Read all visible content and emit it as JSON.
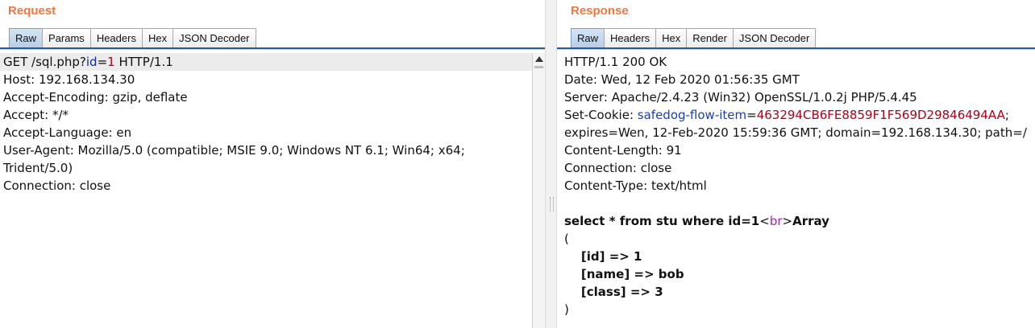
{
  "request": {
    "title": "Request",
    "tabs": [
      "Raw",
      "Params",
      "Headers",
      "Hex",
      "JSON Decoder"
    ],
    "active_tab": "Raw",
    "lines": {
      "l1_prefix": "GET /sql.php?",
      "l1_param": "id",
      "l1_eq": "=",
      "l1_val": "1",
      "l1_suffix": " HTTP/1.1",
      "l2": "Host: 192.168.134.30",
      "l3": "Accept-Encoding: gzip, deflate",
      "l4": "Accept: */*",
      "l5": "Accept-Language: en",
      "l6": "User-Agent: Mozilla/5.0 (compatible; MSIE 9.0; Windows NT 6.1; Win64; x64;",
      "l7": "Trident/5.0)",
      "l8": "Connection: close"
    }
  },
  "response": {
    "title": "Response",
    "tabs": [
      "Raw",
      "Headers",
      "Hex",
      "Render",
      "JSON Decoder"
    ],
    "active_tab": "Raw",
    "lines": {
      "l1": "HTTP/1.1 200 OK",
      "l2": "Date: Wed, 12 Feb 2020 01:56:35 GMT",
      "l3": "Server: Apache/2.4.23 (Win32) OpenSSL/1.0.2j PHP/5.4.45",
      "l4_prefix": "Set-Cookie: ",
      "l4_name": "safedog-flow-item",
      "l4_eq": "=",
      "l4_val": "463294CB6FE8859F1F569D29846494AA",
      "l4_suffix": ";",
      "l5": "expires=Wen, 12-Feb-2020 15:59:36 GMT; domain=192.168.134.30; path=/",
      "l6": "Content-Length: 91",
      "l7": "Connection: close",
      "l8": "Content-Type: text/html",
      "l10_a": "select * from stu where id=1",
      "l10_lt": "<",
      "l10_tag": "br",
      "l10_gt": ">",
      "l10_b": "Array",
      "l11": "(",
      "l12": "    [id] => 1",
      "l13": "    [name] => bob",
      "l14": "    [class] => 3",
      "l15": ")"
    }
  },
  "colors": {
    "title": "#ee7741",
    "param_name": "#0d2c9a",
    "param_value": "#b00017",
    "html_tag": "#9c27b0",
    "tab_active": "#b7cee7"
  }
}
